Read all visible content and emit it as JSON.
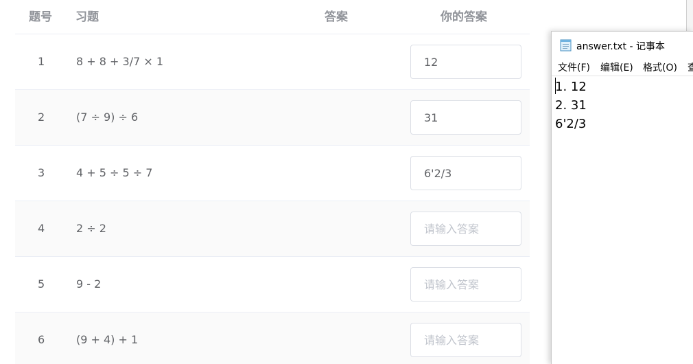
{
  "quiz": {
    "headers": {
      "number": "题号",
      "question": "习题",
      "answer": "答案",
      "your_answer": "你的答案"
    },
    "placeholder": "请输入答案",
    "rows": [
      {
        "no": "1",
        "question": "8 + 8 + 3/7 × 1",
        "your_answer": "12"
      },
      {
        "no": "2",
        "question": "(7 ÷ 9) ÷ 6",
        "your_answer": "31"
      },
      {
        "no": "3",
        "question": "4 + 5 ÷ 5 ÷ 7",
        "your_answer": "6'2/3"
      },
      {
        "no": "4",
        "question": "2 ÷ 2",
        "your_answer": ""
      },
      {
        "no": "5",
        "question": "9 - 2",
        "your_answer": ""
      },
      {
        "no": "6",
        "question": "(9 + 4) + 1",
        "your_answer": ""
      }
    ]
  },
  "notepad": {
    "title": "answer.txt - 记事本",
    "icon": "notepad-icon",
    "menu": {
      "file": "文件(F)",
      "edit": "编辑(E)",
      "format": "格式(O)",
      "view_partial": "查"
    },
    "content": "1. 12\n2. 31\n6'2/3"
  }
}
